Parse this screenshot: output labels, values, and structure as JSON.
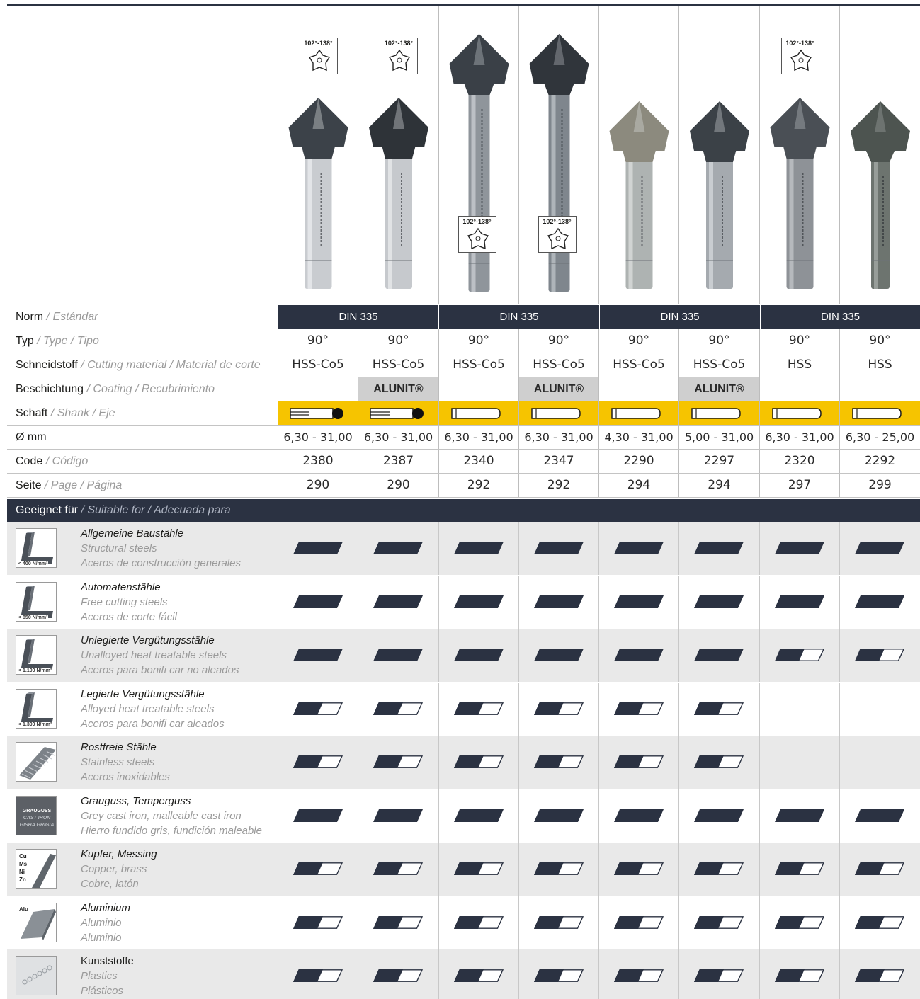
{
  "angle_tag": "102°-138°",
  "columns": [
    {
      "code": "2380",
      "type": "90°",
      "material": "HSS-Co5",
      "coating": "",
      "diameter": "6,30 - 31,00",
      "page": "290",
      "shank": "flat",
      "angle_icon_top": true,
      "angle_icon_mid": false
    },
    {
      "code": "2387",
      "type": "90°",
      "material": "HSS-Co5",
      "coating": "ALUNIT®",
      "diameter": "6,30 - 31,00",
      "page": "290",
      "shank": "flat",
      "angle_icon_top": true,
      "angle_icon_mid": false
    },
    {
      "code": "2340",
      "type": "90°",
      "material": "HSS-Co5",
      "coating": "",
      "diameter": "6,30 - 31,00",
      "page": "292",
      "shank": "cylindrical",
      "angle_icon_top": false,
      "angle_icon_mid": true
    },
    {
      "code": "2347",
      "type": "90°",
      "material": "HSS-Co5",
      "coating": "ALUNIT®",
      "diameter": "6,30 - 31,00",
      "page": "292",
      "shank": "cylindrical",
      "angle_icon_top": false,
      "angle_icon_mid": true
    },
    {
      "code": "2290",
      "type": "90°",
      "material": "HSS-Co5",
      "coating": "",
      "diameter": "4,30 - 31,00",
      "page": "294",
      "shank": "cylindrical",
      "angle_icon_top": false,
      "angle_icon_mid": false
    },
    {
      "code": "2297",
      "type": "90°",
      "material": "HSS-Co5",
      "coating": "ALUNIT®",
      "diameter": "5,00 - 31,00",
      "page": "294",
      "shank": "cylindrical",
      "angle_icon_top": false,
      "angle_icon_mid": false
    },
    {
      "code": "2320",
      "type": "90°",
      "material": "HSS",
      "coating": "",
      "diameter": "6,30 - 31,00",
      "page": "297",
      "shank": "cylindrical",
      "angle_icon_top": true,
      "angle_icon_mid": false
    },
    {
      "code": "2292",
      "type": "90°",
      "material": "HSS",
      "coating": "",
      "diameter": "6,30 - 25,00",
      "page": "299",
      "shank": "cylindrical",
      "angle_icon_top": false,
      "angle_icon_mid": false
    }
  ],
  "norm_groups": [
    "DIN 335",
    "DIN 335",
    "DIN 335",
    "DIN 335"
  ],
  "labels": {
    "norm": {
      "main": "Norm",
      "alt": " / Estándar"
    },
    "type": {
      "main": "Typ",
      "alt": " / Type / Tipo"
    },
    "material": {
      "main": "Schneidstoff",
      "alt": " / Cutting material / Material de corte"
    },
    "coating": {
      "main": "Beschichtung",
      "alt": " / Coating / Recubrimiento"
    },
    "shank": {
      "main": "Schaft",
      "alt": " / Shank / Eje"
    },
    "diameter": {
      "main": "Ø mm",
      "alt": ""
    },
    "code": {
      "main": "Code",
      "alt": " / Código"
    },
    "page": {
      "main": "Seite",
      "alt": " / Page / Página"
    },
    "suitable": {
      "main": "Geeignet für",
      "alt": " / Suitable for / Adecuada para"
    }
  },
  "materials": [
    {
      "de": "Allgemeine Baustähle",
      "en": "Structural steels",
      "es": "Aceros de construcción generales",
      "tag": "< 400 N/mm²",
      "icon": "steel-profile",
      "ratings": [
        2,
        2,
        2,
        2,
        2,
        2,
        2,
        2
      ]
    },
    {
      "de": "Automatenstähle",
      "en": "Free cutting steels",
      "es": "Aceros de corte fácil",
      "tag": "< 850 N/mm²",
      "icon": "steel-profile",
      "ratings": [
        2,
        2,
        2,
        2,
        2,
        2,
        2,
        2
      ]
    },
    {
      "de": "Unlegierte Vergütungsstähle",
      "en": "Unalloyed heat treatable steels",
      "es": "Aceros para bonifi car no aleados",
      "tag": "< 1.100 N/mm²",
      "icon": "steel-profile",
      "ratings": [
        2,
        2,
        2,
        2,
        2,
        2,
        1,
        1
      ]
    },
    {
      "de": "Legierte Vergütungsstähle",
      "en": "Alloyed heat treatable steels",
      "es": "Aceros para bonifi car aleados",
      "tag": "< 1.300 N/mm²",
      "icon": "steel-profile",
      "ratings": [
        1,
        1,
        1,
        1,
        1,
        1,
        0,
        0
      ]
    },
    {
      "de": "Rostfreie Stähle",
      "en": "Stainless steels",
      "es": "Aceros inoxidables",
      "tag": "",
      "icon": "stainless-plate",
      "ratings": [
        1,
        1,
        1,
        1,
        1,
        1,
        0,
        0
      ]
    },
    {
      "de": "Grauguss, Temperguss",
      "en": "Grey cast iron, malleable cast iron",
      "es": "Hierro fundido gris, fundición maleable",
      "tag": "",
      "icon": "cast-iron",
      "icon_text": [
        "GRAUGUSS",
        "CAST IRON",
        "GISHA GRIGIA"
      ],
      "ratings": [
        2,
        2,
        2,
        2,
        2,
        2,
        2,
        2
      ]
    },
    {
      "de": "Kupfer, Messing",
      "en": "Copper, brass",
      "es": "Cobre, latón",
      "tag": "",
      "icon": "copper-rod",
      "icon_text": [
        "Cu",
        "Ms",
        "Ni",
        "Zn"
      ],
      "ratings": [
        1,
        1,
        1,
        1,
        1,
        1,
        1,
        1
      ]
    },
    {
      "de": "Aluminium",
      "en": "Aluminio",
      "es": "Aluminio",
      "tag": "",
      "icon": "aluminium-profile",
      "icon_text": [
        "Alu"
      ],
      "ratings": [
        1,
        1,
        1,
        1,
        1,
        1,
        1,
        1
      ]
    },
    {
      "de": "Kunststoffe",
      "en": "Plastics",
      "es": "Plásticos",
      "tag": "",
      "icon": "plastics",
      "ratings": [
        1,
        1,
        1,
        1,
        1,
        1,
        1,
        1
      ]
    }
  ],
  "colors": {
    "navy": "#2b3242",
    "yellow": "#f6c400",
    "coating_grey": "#cfcfcf",
    "row_shade": "#e9e9e9"
  }
}
